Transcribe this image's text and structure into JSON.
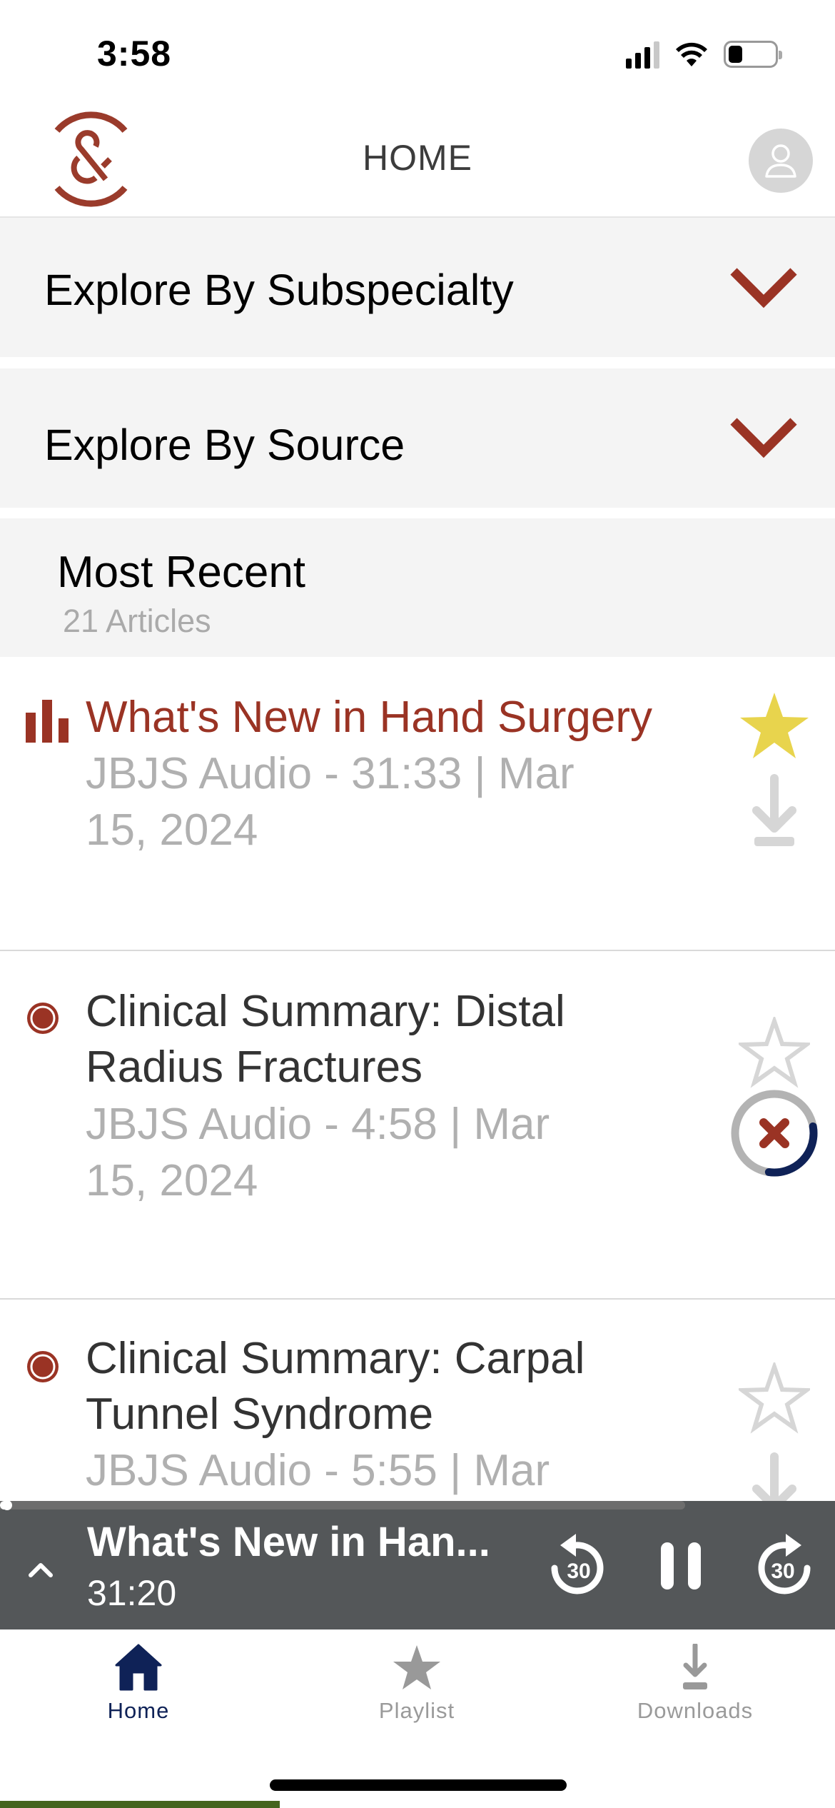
{
  "status_bar": {
    "time": "3:58",
    "signal_bars_on": 3,
    "signal_bars_total": 4,
    "battery_level": 0.3
  },
  "header": {
    "title": "HOME",
    "logo_icon": "ampersand-logo",
    "profile_icon": "user-icon"
  },
  "colors": {
    "brand": "#9a3324",
    "accent_nav": "#0f2257",
    "favorite": "#e8d44d",
    "muted": "#b0b0b0",
    "player_bg": "#545759"
  },
  "explore": [
    {
      "label": "Explore By Subspecialty",
      "icon": "chevron-down-icon"
    },
    {
      "label": "Explore By Source",
      "icon": "chevron-down-icon"
    }
  ],
  "most_recent": {
    "title": "Most Recent",
    "count_label": "21 Articles"
  },
  "items": [
    {
      "title": "What's New in Hand Surgery",
      "meta": "JBJS Audio - 31:33 | Mar 15, 2024",
      "status": "now-playing",
      "favorited": true,
      "download_state": "not-downloaded"
    },
    {
      "title": "Clinical Summary: Distal Radius Fractures",
      "meta": "JBJS Audio - 4:58 | Mar 15, 2024",
      "status": "unplayed",
      "favorited": false,
      "download_state": "downloading",
      "download_progress": 0.3
    },
    {
      "title": "Clinical Summary: Carpal Tunnel Syndrome",
      "meta": "JBJS Audio - 5:55 | Mar",
      "status": "unplayed",
      "favorited": false,
      "download_state": "not-downloaded"
    }
  ],
  "player": {
    "title": "What's New in Han...",
    "time": "31:20",
    "progress": 0.01,
    "skip_back_seconds": "30",
    "skip_forward_seconds": "30",
    "state": "playing"
  },
  "tabs": [
    {
      "label": "Home",
      "icon": "home-icon",
      "active": true
    },
    {
      "label": "Playlist",
      "icon": "star-icon",
      "active": false
    },
    {
      "label": "Downloads",
      "icon": "download-icon",
      "active": false
    }
  ]
}
